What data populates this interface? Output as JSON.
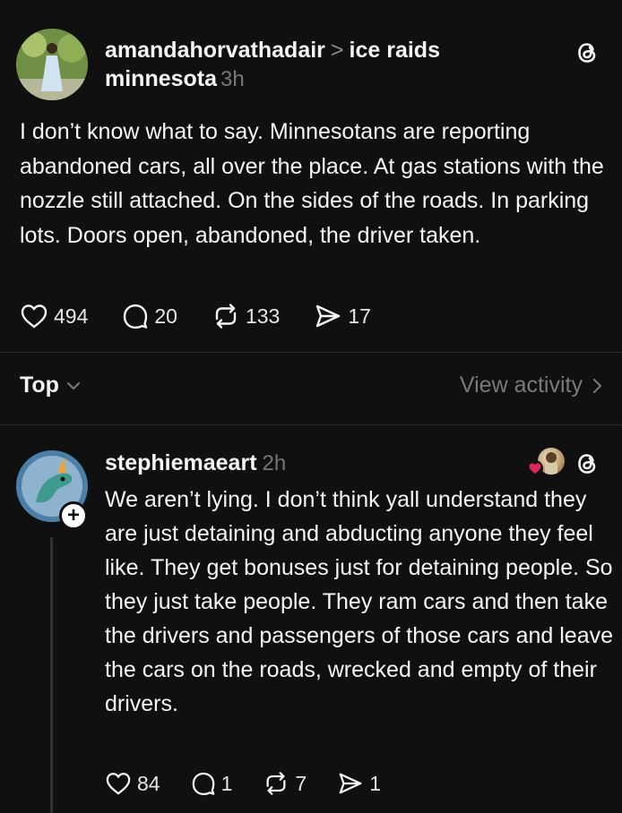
{
  "post": {
    "author": "amandahorvathadair",
    "separator": ">",
    "topic_line1": "ice raids",
    "topic_line2": "minnesota",
    "time": "3h",
    "body": "I don’t know what to say. Minnesotans are reporting abandoned cars, all over the place. At gas stations with the nozzle still attached. On the sides of the roads. In parking lots. Doors open, abandoned, the driver taken.",
    "likes": "494",
    "replies": "20",
    "reposts": "133",
    "shares": "17"
  },
  "sort": {
    "label": "Top",
    "view_activity": "View activity"
  },
  "reply": {
    "author": "stephiemaeart",
    "time": "2h",
    "follow_symbol": "+",
    "body": "We aren’t lying. I don’t think yall understand they are just detaining and abducting anyone they feel like. They get bonuses just for detaining people. So they just take people. They ram cars and then take the drivers and passengers of those cars and leave the cars on the roads, wrecked and empty of their drivers.",
    "likes": "84",
    "replies": "1",
    "reposts": "7",
    "shares": "1"
  },
  "colors": {
    "background": "#101010",
    "text": "#f3f5f7",
    "muted": "#777777",
    "divider": "#2a2a2a",
    "heart_badge": "#e0245e"
  },
  "icons": [
    "threads-logo-icon",
    "heart-icon",
    "comment-icon",
    "repost-icon",
    "share-icon",
    "chevron-down-icon",
    "chevron-right-icon"
  ]
}
